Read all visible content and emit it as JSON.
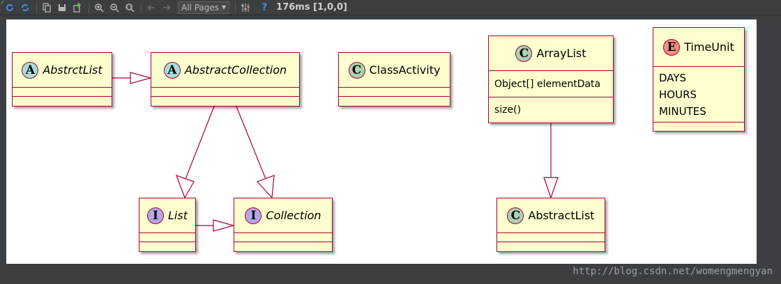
{
  "toolbar": {
    "pages_select": "All Pages",
    "help_glyph": "?",
    "status": "176ms [1,0,0]",
    "icons": [
      "refresh-icon",
      "auto-refresh-icon",
      "copy-icon",
      "save-icon",
      "export-icon",
      "zoom-in-icon",
      "zoom-out-icon",
      "zoom-actual-icon",
      "back-arrow-icon",
      "forward-arrow-icon",
      "settings-icon",
      "help-icon"
    ]
  },
  "diagram": {
    "classes": {
      "abstrctlist": {
        "stereotype": "A",
        "name": "AbstrctList"
      },
      "abstractcollection": {
        "stereotype": "A",
        "name": "AbstractCollection"
      },
      "classactivity": {
        "stereotype": "C",
        "name": "ClassActivity"
      },
      "arraylist": {
        "stereotype": "C",
        "name": "ArrayList",
        "field": "Object[] elementData",
        "method": "size()"
      },
      "timeunit": {
        "stereotype": "E",
        "name": "TimeUnit",
        "values": [
          "DAYS",
          "HOURS",
          "MINUTES"
        ]
      },
      "list": {
        "stereotype": "I",
        "name": "List"
      },
      "collection": {
        "stereotype": "I",
        "name": "Collection"
      },
      "abstractlist": {
        "stereotype": "C",
        "name": "AbstractList"
      }
    },
    "colors": {
      "border": "#a80036",
      "fill": "#fefece",
      "abstract_badge": "#a9dcdf",
      "class_badge": "#add1b2",
      "interface_badge": "#b4a7e5",
      "enum_badge": "#eb937f"
    }
  },
  "watermark": "http://blog.csdn.net/womengmengyan"
}
